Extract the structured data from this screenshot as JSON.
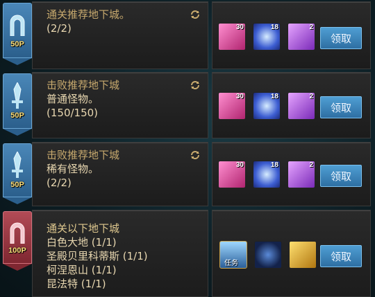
{
  "tasks": [
    {
      "points": "50P",
      "badge_icon": "arch-icon",
      "badge_color": "#3b76a6",
      "lines": [
        "通关推荐地下城。",
        "(2/2)"
      ],
      "rewards": [
        {
          "icon": "pink-ticket-icon",
          "count": "30"
        },
        {
          "icon": "blue-crystal-icon",
          "count": "18"
        },
        {
          "icon": "purple-box-icon",
          "count": "2"
        }
      ],
      "claim_label": "领取"
    },
    {
      "points": "50P",
      "badge_icon": "sword-icon",
      "badge_color": "#3b76a6",
      "lines": [
        "击败推荐地下城",
        "普通怪物。",
        "(150/150)"
      ],
      "rewards": [
        {
          "icon": "pink-ticket-icon",
          "count": "30"
        },
        {
          "icon": "blue-crystal-icon",
          "count": "18"
        },
        {
          "icon": "purple-box-icon",
          "count": "2"
        }
      ],
      "claim_label": "领取"
    },
    {
      "points": "50P",
      "badge_icon": "sword-icon",
      "badge_color": "#3b76a6",
      "lines": [
        "击败推荐地下城",
        "稀有怪物。",
        "(2/2)"
      ],
      "rewards": [
        {
          "icon": "pink-ticket-icon",
          "count": "30"
        },
        {
          "icon": "blue-crystal-icon",
          "count": "18"
        },
        {
          "icon": "purple-box-icon",
          "count": "2"
        }
      ],
      "claim_label": "领取"
    },
    {
      "points": "100P",
      "badge_icon": "arch-icon",
      "badge_color": "#9c3a45",
      "lines": [
        "通关以下地下城",
        "白色大地 (1/1)",
        "圣殿贝里科蒂斯 (1/1)",
        "柯涅恩山 (1/1)",
        "昆法特 (1/1)"
      ],
      "rewards": [
        {
          "icon": "quest-scroll-icon",
          "count": "",
          "label": "任务"
        },
        {
          "icon": "dark-chest-icon",
          "count": ""
        },
        {
          "icon": "gold-anvil-icon",
          "count": ""
        }
      ],
      "claim_label": "领取"
    }
  ]
}
